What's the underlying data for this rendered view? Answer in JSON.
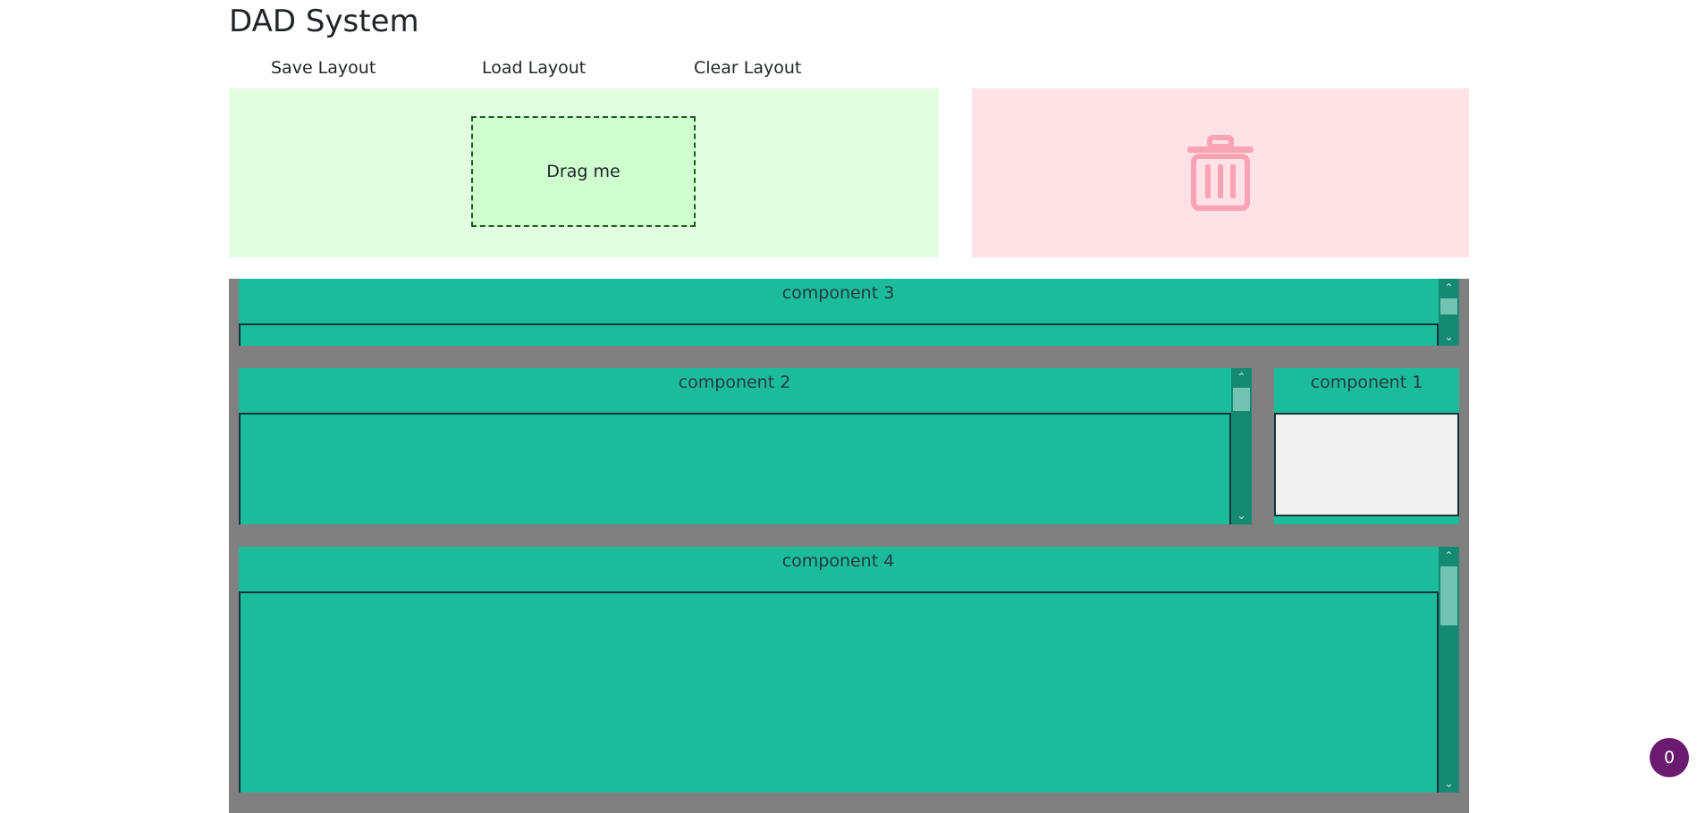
{
  "app": {
    "title": "DAD System"
  },
  "toolbar": {
    "save_label": "Save Layout",
    "load_label": "Load Layout",
    "clear_label": "Clear Layout"
  },
  "drop_zone": {
    "drag_item_label": "Drag me"
  },
  "trash_zone": {
    "icon": "trash-icon",
    "icon_color": "#f9a3b4"
  },
  "components": {
    "c3": {
      "label": "component 3"
    },
    "c2": {
      "label": "component 2"
    },
    "c1": {
      "label": "component 1"
    },
    "c4": {
      "label": "component 4"
    }
  },
  "badge": {
    "count": "0"
  },
  "colors": {
    "drop_zone_bg": "#e3fde3",
    "drag_item_bg": "#cfffcf",
    "trash_zone_bg": "#ffe2e5",
    "layout_area_bg": "#808080",
    "component_bg": "#1abc9c",
    "badge_bg": "#6a1b6f"
  }
}
